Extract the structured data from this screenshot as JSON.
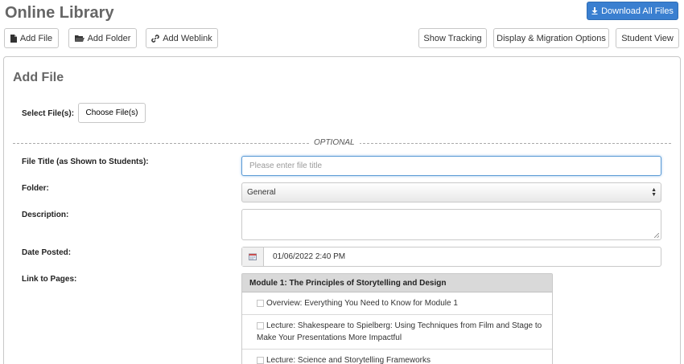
{
  "header": {
    "title": "Online Library",
    "download_all_label": "Download All Files"
  },
  "toolbar": {
    "add_file_label": "Add File",
    "add_folder_label": "Add Folder",
    "add_weblink_label": "Add Weblink",
    "show_tracking_label": "Show Tracking",
    "display_migration_label": "Display & Migration Options",
    "student_view_label": "Student View"
  },
  "form": {
    "title": "Add File",
    "select_files_label": "Select File(s):",
    "choose_files_label": "Choose File(s)",
    "optional_label": "OPTIONAL",
    "file_title_label": "File Title (as Shown to Students):",
    "file_title_placeholder": "Please enter file title",
    "folder_label": "Folder:",
    "folder_value": "General",
    "description_label": "Description:",
    "date_posted_label": "Date Posted:",
    "date_posted_value": "01/06/2022 2:40 PM",
    "link_to_pages_label": "Link to Pages:"
  },
  "pages": {
    "module_title": "Module 1: The Principles of Storytelling and Design",
    "items": [
      "Overview: Everything You Need to Know for Module 1",
      "Lecture: Shakespeare to Spielberg: Using Techniques from Film and Stage to Make Your Presentations More Impactful",
      "Lecture: Science and Storytelling Frameworks"
    ]
  },
  "colors": {
    "primary": "#3a7fd0",
    "focus_border": "#5b9bd5",
    "header_gray": "#d9d9d9"
  },
  "icons": [
    "download-icon",
    "file-icon",
    "folder-icon",
    "link-icon",
    "calendar-icon",
    "chevron-updown-icon"
  ]
}
